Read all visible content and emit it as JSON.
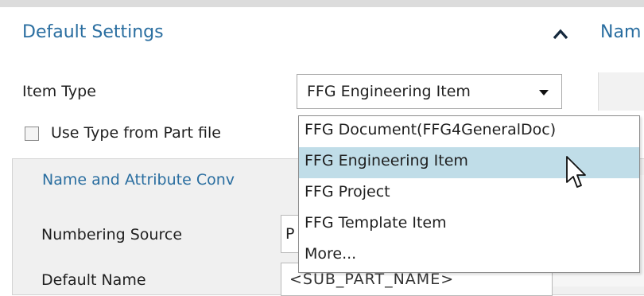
{
  "header": {
    "section_title": "Default Settings",
    "right_title": "Nam"
  },
  "item_type": {
    "label": "Item Type",
    "selected_value": "FFG Engineering Item"
  },
  "use_type_checkbox": {
    "label": "Use Type from Part file",
    "checked": false
  },
  "group": {
    "title": "Name and Attribute Conv",
    "numbering_source_label": "Numbering Source",
    "numbering_source_value": "P",
    "default_name_label": "Default Name",
    "default_name_value": "<SUB_PART_NAME>"
  },
  "dropdown": {
    "options": [
      "FFG Document(FFG4GeneralDoc)",
      "FFG Engineering Item",
      "FFG Project",
      "FFG Template Item",
      "More..."
    ],
    "highlighted_index": 1
  },
  "colors": {
    "accent": "#2a6ea0",
    "highlight": "#c0dde8",
    "panel": "#f0f0f0"
  },
  "icons": {
    "collapse": "chevron-up-icon",
    "dropdown": "caret-down-icon",
    "cursor": "mouse-pointer-icon"
  }
}
